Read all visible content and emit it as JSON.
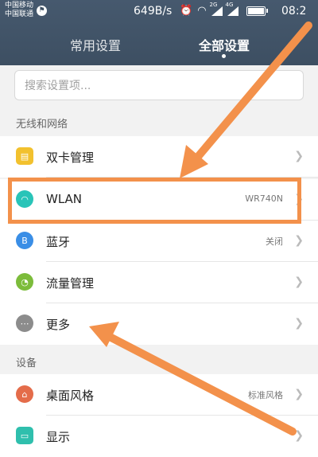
{
  "status_bar": {
    "carrier_1": "中国移动",
    "carrier_2": "中国联通",
    "net_speed": "649B/s",
    "signal_labels": [
      "2G",
      "4G"
    ],
    "time": "08:2"
  },
  "tabs": [
    {
      "label": "常用设置",
      "active": false
    },
    {
      "label": "全部设置",
      "active": true
    }
  ],
  "search": {
    "placeholder": "搜索设置项..."
  },
  "sections": {
    "wireless": "无线和网络",
    "device": "设备"
  },
  "items": {
    "dual_sim": {
      "label": "双卡管理",
      "value": ""
    },
    "wlan": {
      "label": "WLAN",
      "value": "WR740N"
    },
    "bluetooth": {
      "label": "蓝牙",
      "value": "关闭"
    },
    "data": {
      "label": "流量管理",
      "value": ""
    },
    "more": {
      "label": "更多",
      "value": ""
    },
    "theme": {
      "label": "桌面风格",
      "value": "标准风格"
    },
    "display": {
      "label": "显示",
      "value": ""
    }
  },
  "colors": {
    "header": "#3d4f62",
    "annotation": "#f3914b",
    "dual_sim_icon": "#f2c12e",
    "wlan_icon": "#29c4b8",
    "bluetooth_icon": "#3a8ee6",
    "data_icon": "#7cbc3b",
    "more_icon": "#8c8c8c",
    "theme_icon": "#e46c4a",
    "display_icon": "#2fbfad"
  }
}
